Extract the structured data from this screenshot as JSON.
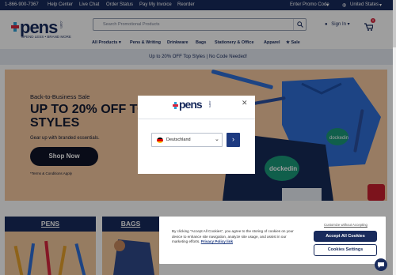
{
  "topbar": {
    "phone": "1-866-900-7367",
    "help": "Help Center",
    "chat": "Live Chat",
    "order_status": "Order Status",
    "pay_invoice": "Pay My Invoice",
    "reorder": "Reorder",
    "promo_code": "Enter Promo Code",
    "country": "United States"
  },
  "header": {
    "logo_word": "pens",
    "logo_suffix": ".com",
    "logo_tagline": "SPEND LESS • BRAND MORE",
    "search_placeholder": "Search Promotional Products",
    "signin": "Sign In",
    "cart_count": "0"
  },
  "nav": {
    "items": [
      "All Products",
      "Pens & Writing",
      "Drinkware",
      "Bags",
      "Stationery & Office",
      "Apparel",
      "Sale"
    ]
  },
  "promo_bar": {
    "text": "Up to 20% OFF Top Styles | No Code Needed!"
  },
  "hero": {
    "eyebrow": "Back-to-Business Sale",
    "headline": "UP TO 20% OFF TOP STYLES",
    "sub": "Gear up with branded essentials.",
    "cta": "Shop Now",
    "terms": "*Terms & Conditions Apply",
    "art_text_1": "dockedin",
    "art_text_2": "dockedin"
  },
  "categories": [
    {
      "label": "PENS"
    },
    {
      "label": "BAGS"
    }
  ],
  "country_modal": {
    "logo_word": "pens",
    "logo_suffix": ".com",
    "selected_country": "Deutschland",
    "go_label": "›"
  },
  "cookie_banner": {
    "text": "By clicking \"Accept All Cookies\", you agree to the storing of cookies on your device to enhance site navigation, analyze site usage, and assist in our marketing efforts.",
    "policy_link": "Privacy Policy link",
    "customize": "Customize without Accepting",
    "accept": "Accept All Cookies",
    "settings": "Cookies Settings"
  },
  "colors": {
    "navy": "#182a5c",
    "hero_bg": "#f5c9a0",
    "accent_red": "#d7263d",
    "button_blue": "#1d3a80"
  }
}
